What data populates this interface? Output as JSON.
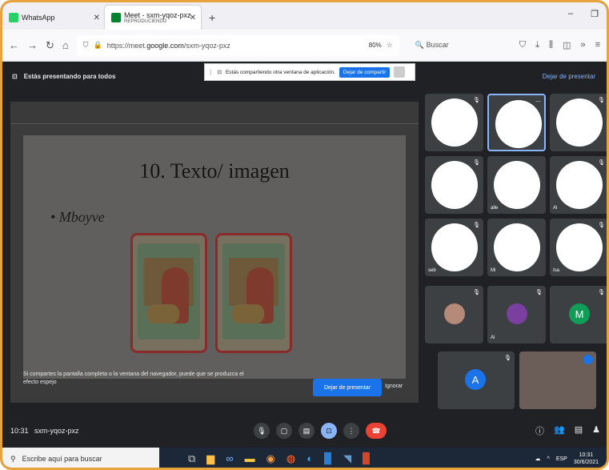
{
  "browser": {
    "tabs": [
      {
        "label": "WhatsApp"
      },
      {
        "label": "Meet - sxm-yqoz-pxz",
        "sublabel": "REPRODUCIENDO"
      }
    ],
    "url_prefix": "https://meet.",
    "url_host": "google.com",
    "url_path": "/sxm-yqoz-pxz",
    "zoom": "80%",
    "search_placeholder": "Buscar"
  },
  "presenting": {
    "label": "Estás presentando para todos",
    "stop_label": "Dejar de presentar"
  },
  "share_banner": {
    "text": "Estás compartiendo otra ventana de aplicación.",
    "button": "Dejar de compartir"
  },
  "slide": {
    "title": "10. Texto/ imagen",
    "bullet": "• Mboyve"
  },
  "notice": {
    "text": "Si compartes la pantalla completa o la ventana del navegador, puede que se produzca el efecto espejo",
    "primary": "Dejar de presentar",
    "secondary": "Ignorar"
  },
  "participants": [
    {
      "name": "",
      "kind": "face"
    },
    {
      "name": "",
      "kind": "face"
    },
    {
      "name": "",
      "kind": "face"
    },
    {
      "name": "",
      "kind": "face"
    },
    {
      "name": "alle",
      "kind": "face"
    },
    {
      "name": "Al",
      "kind": "face"
    },
    {
      "name": "seb",
      "kind": "face"
    },
    {
      "name": "Mi",
      "kind": "face"
    },
    {
      "name": "Isa",
      "kind": "face"
    },
    {
      "name": "",
      "kind": "face"
    },
    {
      "name": "Al",
      "kind": "face"
    },
    {
      "name": "",
      "kind": "avatar",
      "letter": "M",
      "color": "#0f9d58"
    },
    {
      "name": "",
      "kind": "avatar",
      "letter": "A",
      "color": "#1a73e8"
    }
  ],
  "meeting": {
    "time": "10:31",
    "code": "sxm-yqoz-pxz"
  },
  "taskbar": {
    "search": "Escribe aquí para buscar",
    "lang": "ESP",
    "time": "10:31",
    "date": "30/6/2021"
  },
  "colors": {
    "accent": "#1a73e8",
    "end": "#ea4335",
    "frame": "#e7a43c"
  }
}
